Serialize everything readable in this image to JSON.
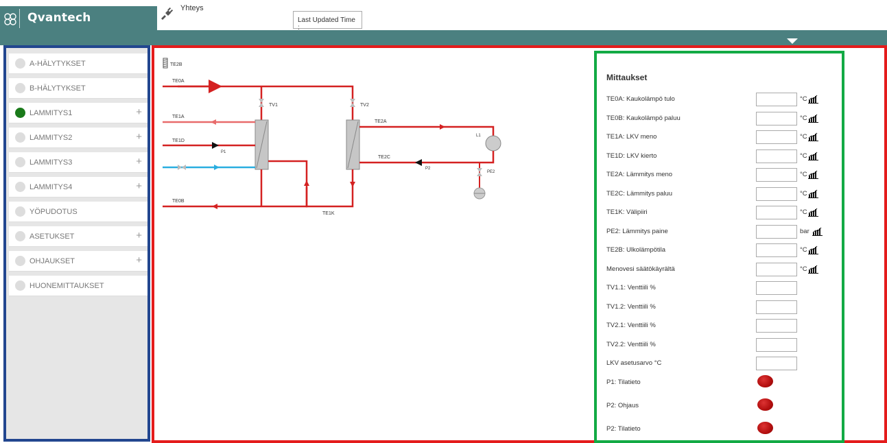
{
  "header": {
    "brand": "Qvantech",
    "connection_label": "Yhteys",
    "last_updated_label": "Last Updated Time :"
  },
  "sidebar": {
    "items": [
      {
        "label": "A-HÄLYTYKSET",
        "active": false,
        "expandable": false
      },
      {
        "label": "B-HÄLYTYKSET",
        "active": false,
        "expandable": false
      },
      {
        "label": "LAMMITYS1",
        "active": true,
        "expandable": true
      },
      {
        "label": "LAMMITYS2",
        "active": false,
        "expandable": true
      },
      {
        "label": "LAMMITYS3",
        "active": false,
        "expandable": true
      },
      {
        "label": "LAMMITYS4",
        "active": false,
        "expandable": true
      },
      {
        "label": "YÖPUDOTUS",
        "active": false,
        "expandable": false
      },
      {
        "label": "ASETUKSET",
        "active": false,
        "expandable": true
      },
      {
        "label": "OHJAUKSET",
        "active": false,
        "expandable": true
      },
      {
        "label": "HUONEMITTAUKSET",
        "active": false,
        "expandable": false
      }
    ]
  },
  "diagram": {
    "labels": {
      "te2b": "TE2B",
      "te0a": "TE0A",
      "tv1": "TV1",
      "tv2": "TV2",
      "te1a": "TE1A",
      "te2a": "TE2A",
      "te1d": "TE1D",
      "p1": "P1",
      "l1": "L1",
      "te2c": "TE2C",
      "p2": "P2",
      "pe2": "PE2",
      "te0b": "TE0B",
      "te1k": "TE1K"
    },
    "colors": {
      "hot": "#d42121",
      "warm": "#e86b6b",
      "cold": "#29aee0",
      "hx": "#c6c6c6"
    }
  },
  "panel": {
    "title": "Mittaukset",
    "measurements": [
      {
        "label": "TE0A: Kaukolämpö tulo",
        "unit": "°C",
        "chart": true
      },
      {
        "label": "TE0B: Kaukolämpö paluu",
        "unit": "°C",
        "chart": true
      },
      {
        "label": "TE1A: LKV meno",
        "unit": "°C",
        "chart": true
      },
      {
        "label": "TE1D: LKV kierto",
        "unit": "°C",
        "chart": true
      },
      {
        "label": "TE2A: Lämmitys meno",
        "unit": "°C",
        "chart": true
      },
      {
        "label": "TE2C: Lämmitys paluu",
        "unit": "°C",
        "chart": true
      },
      {
        "label": "TE1K: Välipiiri",
        "unit": "°C",
        "chart": true
      },
      {
        "label": "PE2: Lämmitys paine",
        "unit": "bar",
        "chart": true
      },
      {
        "label": "TE2B: Ulkolämpötila",
        "unit": "°C",
        "chart": true
      },
      {
        "label": "Menovesi säätökäyrältä",
        "unit": "°C",
        "chart": true
      },
      {
        "label": "TV1.1: Venttiili %",
        "unit": "",
        "chart": false
      },
      {
        "label": "TV1.2: Venttiili %",
        "unit": "",
        "chart": false
      },
      {
        "label": "TV2.1: Venttiili %",
        "unit": "",
        "chart": false
      },
      {
        "label": "TV2.2: Venttiili %",
        "unit": "",
        "chart": false
      },
      {
        "label": "LKV asetusarvo °C",
        "unit": "",
        "chart": false
      }
    ],
    "statuses": [
      {
        "label": "P1: Tilatieto",
        "state_color": "#b20e0e"
      },
      {
        "label": "P2: Ohjaus",
        "state_color": "#b20e0e"
      },
      {
        "label": "P2: Tilatieto",
        "state_color": "#b20e0e"
      }
    ]
  }
}
